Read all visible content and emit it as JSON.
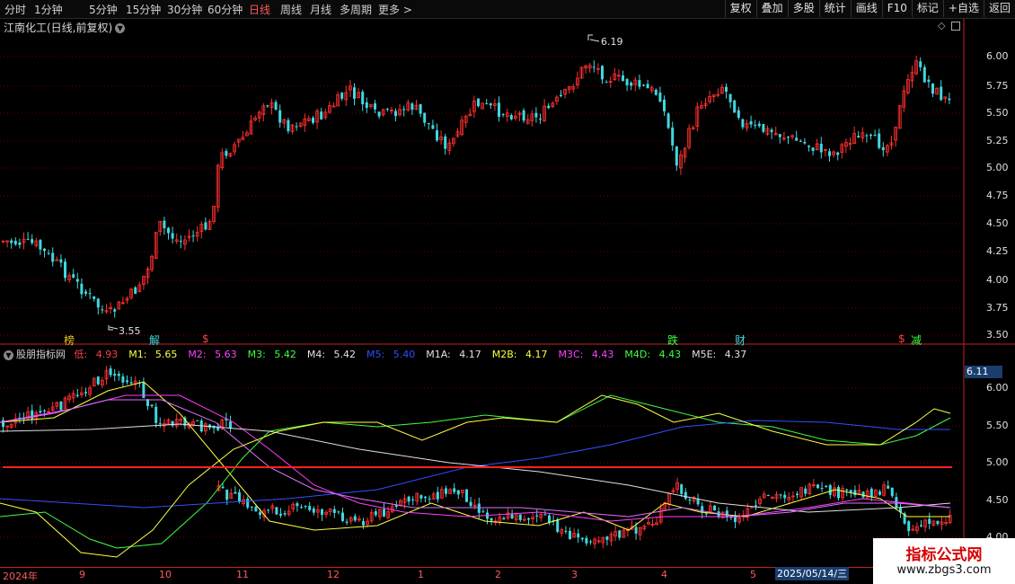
{
  "toolbar": {
    "periods": [
      "分时",
      "1分钟",
      "5分钟",
      "15分钟",
      "30分钟",
      "60分钟",
      "日线",
      "周线",
      "月线",
      "多周期",
      "更多 >"
    ],
    "active_period": "日线",
    "buttons": [
      "复权",
      "叠加",
      "多股",
      "统计",
      "画线",
      "F10",
      "标记",
      "+自选",
      "返回"
    ]
  },
  "stock": {
    "title": "江南化工(日线,前复权)"
  },
  "price_axis": [
    "6.00",
    "5.75",
    "5.50",
    "5.25",
    "5.00",
    "4.75",
    "4.50",
    "4.25",
    "4.00",
    "3.75",
    "3.50"
  ],
  "indicator_axis": [
    "6.00",
    "5.50",
    "5.00",
    "4.50",
    "4.00"
  ],
  "annotations": {
    "high": "6.19",
    "low": "3.55"
  },
  "events": [
    {
      "label": "榜",
      "color": "#e8c020"
    },
    {
      "label": "解",
      "color": "#40d8e0"
    },
    {
      "label": "$",
      "color": "#ff4040"
    },
    {
      "label": "跌",
      "color": "#40ff40"
    },
    {
      "label": "财",
      "color": "#40d8e0"
    },
    {
      "label": "$",
      "color": "#ff4040"
    },
    {
      "label": "减",
      "color": "#40ff40"
    }
  ],
  "indicator": {
    "name": "股朋指标网",
    "items": [
      {
        "label": "低:",
        "value": "4.93",
        "color": "#ff4040"
      },
      {
        "label": "M1:",
        "value": "5.65",
        "color": "#ffff40"
      },
      {
        "label": "M2:",
        "value": "5.63",
        "color": "#ff40ff"
      },
      {
        "label": "M3:",
        "value": "5.42",
        "color": "#40ff40"
      },
      {
        "label": "M4:",
        "value": "5.42",
        "color": "#e0e0e0"
      },
      {
        "label": "M5:",
        "value": "5.40",
        "color": "#2040ff"
      },
      {
        "label": "M1A:",
        "value": "4.17",
        "color": "#e0e0e0"
      },
      {
        "label": "M2B:",
        "value": "4.17",
        "color": "#ffff40"
      },
      {
        "label": "M3C:",
        "value": "4.43",
        "color": "#ff40ff"
      },
      {
        "label": "M4D:",
        "value": "4.43",
        "color": "#40ff40"
      },
      {
        "label": "M5E:",
        "value": "4.37",
        "color": "#e0e0e0"
      }
    ]
  },
  "current_price": "6.11",
  "date_axis": [
    "2024年",
    "9",
    "10",
    "11",
    "12",
    "1",
    "2",
    "3",
    "4",
    "5"
  ],
  "cursor_date": "2025/05/14/三",
  "watermark": {
    "title": "指标公式网",
    "url": "www.zbgs3.com"
  },
  "colors": {
    "up": "#ff3030",
    "down": "#40d8e0",
    "grid": "#6a0000",
    "axis": "#c82020"
  }
}
